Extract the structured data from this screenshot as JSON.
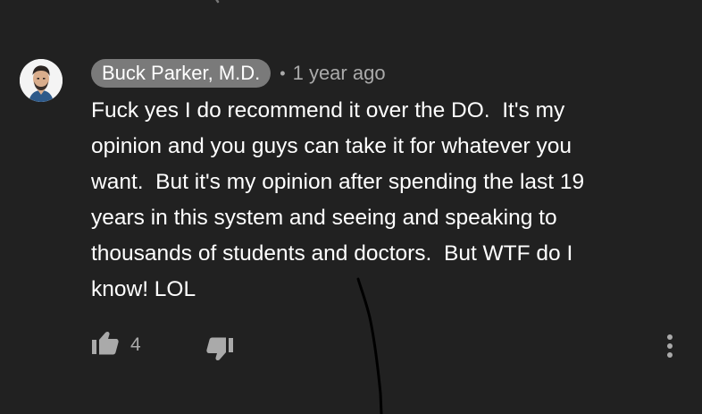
{
  "comment": {
    "author": "Buck Parker, M.D.",
    "separator": "•",
    "timestamp": "1 year ago",
    "lines": [
      "Fuck yes I do recommend it over the DO.  It's my",
      "opinion and you guys can take it for whatever you",
      "want.  But it's my opinion after spending the last 19",
      "years in this system and seeing and speaking to",
      "thousands of students and doctors.  But WTF do I",
      "know! LOL"
    ],
    "like_count": "4"
  },
  "icons": {
    "avatar": "avatar",
    "like": "thumbs-up-icon",
    "dislike": "thumbs-down-icon",
    "more": "more-vertical-icon"
  },
  "colors": {
    "background": "#212121",
    "text_primary": "#ffffff",
    "text_secondary": "#aaaaaa",
    "author_pill": "#7a7a7a",
    "icon": "#aaaaaa"
  }
}
